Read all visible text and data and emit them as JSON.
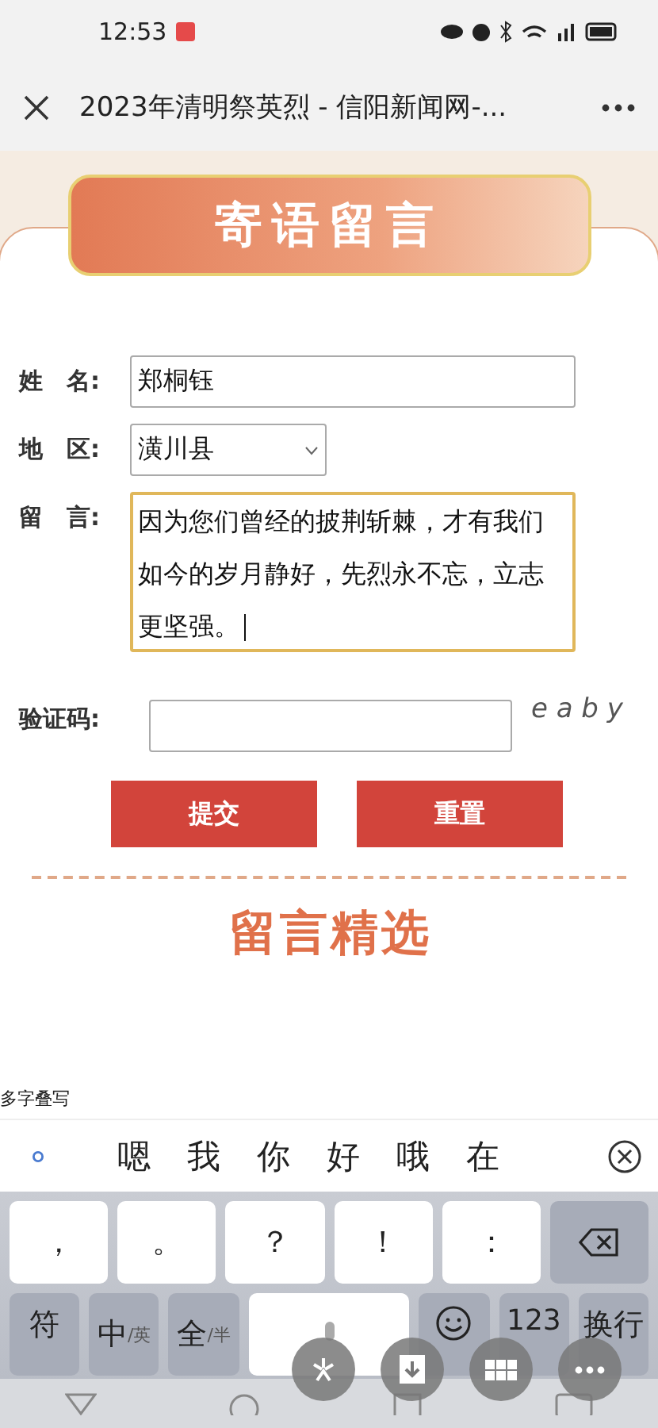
{
  "status_bar": {
    "time": "12:53"
  },
  "title_bar": {
    "title": "2023年清明祭英烈 - 信阳新闻网-..."
  },
  "form": {
    "header": "寄语留言",
    "name": {
      "label": "姓　名:",
      "value": "郑桐钰"
    },
    "region": {
      "label": "地　区:",
      "value": "潢川县"
    },
    "message": {
      "label": "留　言:",
      "value": "因为您们曾经的披荆斩棘，才有我们如今的岁月静好，先烈永不忘，立志更坚强。",
      "focused": true
    },
    "captcha": {
      "label": "验证码:",
      "code": "e a b y"
    },
    "buttons": [
      "提交",
      "重置"
    ],
    "section_title": "留言精选"
  },
  "keyboard": {
    "mode_hint": "多字叠写",
    "candidates": [
      "嗯",
      "我",
      "你",
      "好",
      "哦",
      "在"
    ],
    "row_1": [
      "，",
      "。",
      "？",
      "！",
      "："
    ],
    "row_2": [
      {
        "kind": "text",
        "label": "符"
      },
      {
        "kind": "toggle",
        "label": "中",
        "sub": "/英"
      },
      {
        "kind": "toggle",
        "label": "全",
        "sub": "/半"
      },
      {
        "kind": "space"
      },
      {
        "kind": "emoji"
      },
      {
        "kind": "text",
        "label": "123"
      },
      {
        "kind": "text",
        "label": "换行"
      }
    ]
  }
}
